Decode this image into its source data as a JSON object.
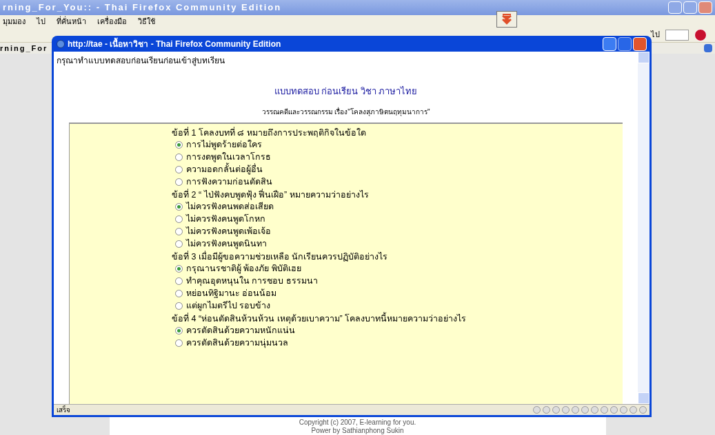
{
  "back_window": {
    "title": "rning_For_You:: - Thai Firefox Community Edition",
    "menu": [
      "มุมมอง",
      "ไป",
      "ที่คั่นหน้า",
      "เครื่องมือ",
      "วิธีใช้"
    ],
    "go_button": "ไป",
    "tab": "rning_For",
    "footer": [
      "Copyright (c) 2007, E-learning for you.",
      "Power by Sathianphong Sukin"
    ]
  },
  "popup": {
    "title": "http://tae - เนื้อหาวิชา - Thai Firefox Community Edition",
    "instruction": "กรุณาทำแบบทดสอบก่อนเรียนก่อนเข้าสู่บทเรียน",
    "heading": "แบบทดสอบ ก่อนเรียน วิชา ภาษาไทย",
    "subheading": "วรรณคดีและวรรณกรรม เรื่อง\"โคลงสุภาษิตนฤทุมนาการ\"",
    "status": "เสร็จ"
  },
  "questions": [
    {
      "text": "ข้อที่ 1 โคลงบทที่ ๘ หมายถึงการประพฤติกิจในข้อใด",
      "options": [
        {
          "label": "การไม่พูดร้ายต่อใคร",
          "selected": true
        },
        {
          "label": "การงดพูดในเวลาโกรธ",
          "selected": false
        },
        {
          "label": "ความอดกลั้นต่อผู้อื่น",
          "selected": false
        },
        {
          "label": "การฟังความก่อนตัดสิน",
          "selected": false
        }
      ]
    },
    {
      "text": "ข้อที่ 2 “ ไป่ฟังคบพูดฟุ้ง ฟื่นเฝือ” หมายความว่าอย่างไร",
      "options": [
        {
          "label": "ไม่ควรฟังคนพดส่อเสียด",
          "selected": true
        },
        {
          "label": "ไม่ควรฟังคนพูดโกหก",
          "selected": false
        },
        {
          "label": "ไม่ควรฟังคนพูดเพ้อเจ้อ",
          "selected": false
        },
        {
          "label": "ไม่ควรฟังคนพูดนินทา",
          "selected": false
        }
      ]
    },
    {
      "text": "ข้อที่ 3 เมื่อมีผู้ขอความช่วยเหลือ นักเรียนควรปฏิบัติอย่างไร",
      "options": [
        {
          "label": "กรุณานรชาติผู้ พ้องภัย พิบัติเฮย",
          "selected": true
        },
        {
          "label": "ทำคุณอุดหนุนใน การชอบ ธรรมนา",
          "selected": false
        },
        {
          "label": "หย่อนทิฐิมานะ อ่อนน้อม",
          "selected": false
        },
        {
          "label": "แต่ผูกไมตรีไป รอบข้าง",
          "selected": false
        }
      ]
    },
    {
      "text": "ข้อที่ 4 “ห่อนตัดสินห้วนห้วน เหตุด้วยเบาความ” โคลงบาทนี้หมายความว่าอย่างไร",
      "options": [
        {
          "label": "ควรตัดสินด้วยความหนักแน่น",
          "selected": true
        },
        {
          "label": "ควรตัดสินด้วยความนุ่มนวล",
          "selected": false
        }
      ]
    }
  ]
}
